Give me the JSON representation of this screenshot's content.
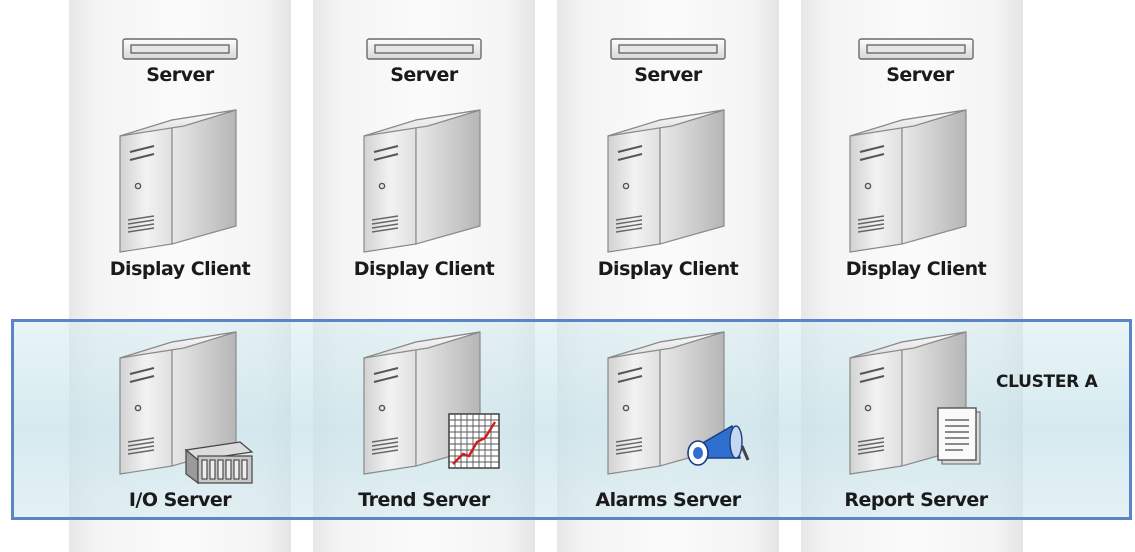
{
  "columns": [
    {
      "rack_label": "Server",
      "client_label": "Display Client",
      "server_label": "I/O Server",
      "server_badge": "io-module-icon"
    },
    {
      "rack_label": "Server",
      "client_label": "Display Client",
      "server_label": "Trend Server",
      "server_badge": "trend-chart-icon"
    },
    {
      "rack_label": "Server",
      "client_label": "Display Client",
      "server_label": "Alarms Server",
      "server_badge": "megaphone-icon"
    },
    {
      "rack_label": "Server",
      "client_label": "Display Client",
      "server_label": "Report Server",
      "server_badge": "document-icon"
    }
  ],
  "cluster": {
    "label": "CLUSTER A",
    "border_color": "#5b86c5"
  }
}
